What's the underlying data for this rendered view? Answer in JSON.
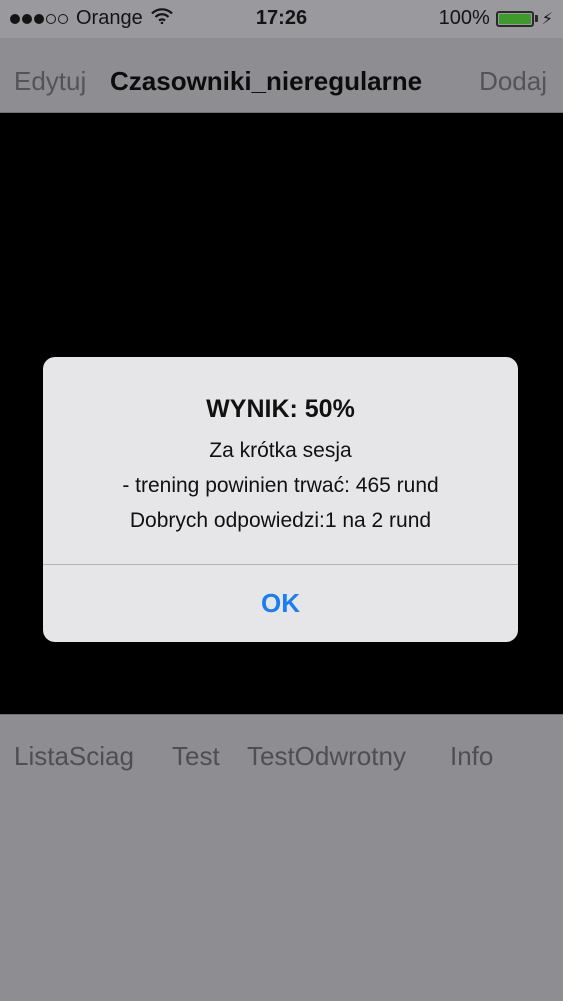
{
  "status_bar": {
    "carrier": "Orange",
    "time": "17:26",
    "battery_percent": "100%",
    "signal_bars_filled": 3,
    "signal_bars_total": 5,
    "battery_level": 1.0
  },
  "nav": {
    "edit_label": "Edytuj",
    "title": "Czasowniki_nieregularne",
    "add_label": "Dodaj"
  },
  "alert": {
    "title": "WYNIK: 50%",
    "line1": "Za krótka sesja",
    "line2": "- trening powinien trwać: 465 rund",
    "line3": "Dobrych odpowiedzi:1 na 2 rund",
    "ok_label": "OK"
  },
  "toolbar": {
    "items": [
      {
        "label": "ListaSciag"
      },
      {
        "label": "Test"
      },
      {
        "label": "TestOdwrotny"
      },
      {
        "label": "Info"
      }
    ]
  },
  "colors": {
    "accent": "#1a7ef2",
    "battery": "#3e9a2a",
    "overlay_background": "#8e8d92"
  }
}
